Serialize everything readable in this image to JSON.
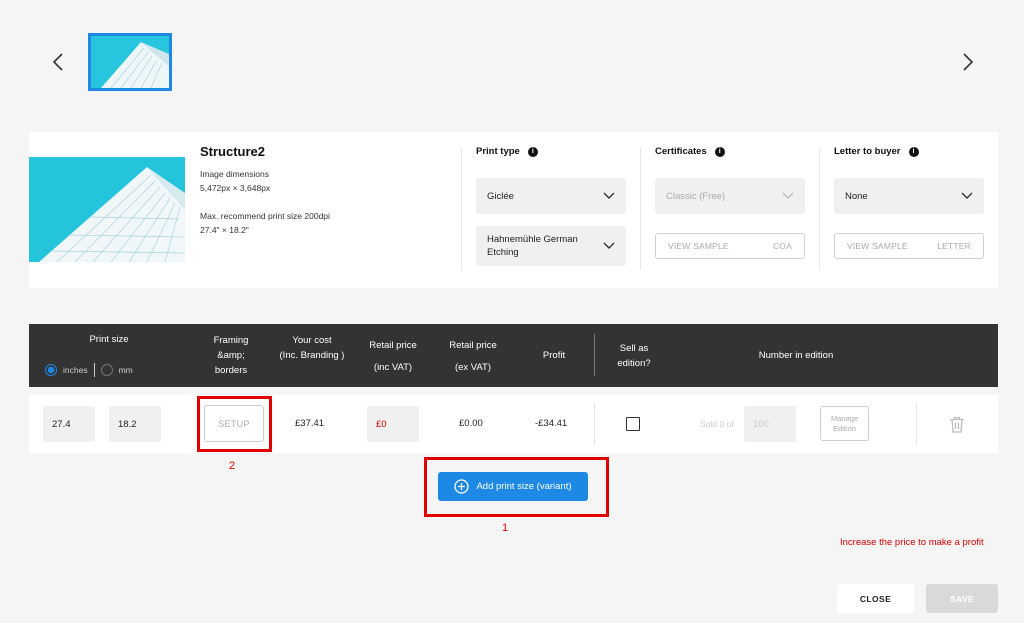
{
  "artwork": {
    "title": "Structure2",
    "dimensions_label": "Image dimensions",
    "dimensions_value": "5,472px × 3,648px",
    "recommend_label": "Max. recommend print size 200dpi",
    "recommend_value": "27.4\" × 18.2\""
  },
  "print_type": {
    "label": "Print type",
    "type_value": "Giclée",
    "paper_value_line1": "Hahnemühle German",
    "paper_value_line2": "Etching"
  },
  "certificates": {
    "label": "Certificates",
    "value": "Classic (Free)",
    "sample_label": "VIEW SAMPLE",
    "sample_tag": "COA"
  },
  "letter": {
    "label": "Letter to buyer",
    "value": "None",
    "sample_label": "VIEW SAMPLE",
    "sample_tag": "LETTER"
  },
  "table": {
    "headers": {
      "print_size": "Print size",
      "unit_inches": "inches",
      "unit_mm": "mm",
      "framing_1": "Framing",
      "framing_2": "&amp;",
      "framing_3": "borders",
      "your_cost_1": "Your cost",
      "your_cost_2": "(Inc. Branding )",
      "retail_inc_1": "Retail price",
      "retail_inc_2": "(inc VAT)",
      "retail_ex_1": "Retail price",
      "retail_ex_2": "(ex VAT)",
      "profit": "Profit",
      "sell_edition_1": "Sell as",
      "sell_edition_2": "edition?",
      "number_in_edition": "Number in edition"
    },
    "row": {
      "width": "27.4",
      "height": "18.2",
      "setup_label": "SETUP",
      "your_cost": "£37.41",
      "retail_inc": "£0",
      "retail_ex": "£0.00",
      "profit": "-£34.41",
      "sold_label": "Sold 0 of",
      "edition_size": "100",
      "manage_line1": "Manage",
      "manage_line2": "Edition"
    }
  },
  "annotations": {
    "one": "1",
    "two": "2"
  },
  "add_variant_label": "Add print size (variant)",
  "warning": "Increase the price to make a profit",
  "footer": {
    "close": "CLOSE",
    "save": "SAVE"
  },
  "colors": {
    "accent": "#1e88e5",
    "header": "#333333",
    "warning": "#d40000",
    "annotation": "#e00000"
  }
}
